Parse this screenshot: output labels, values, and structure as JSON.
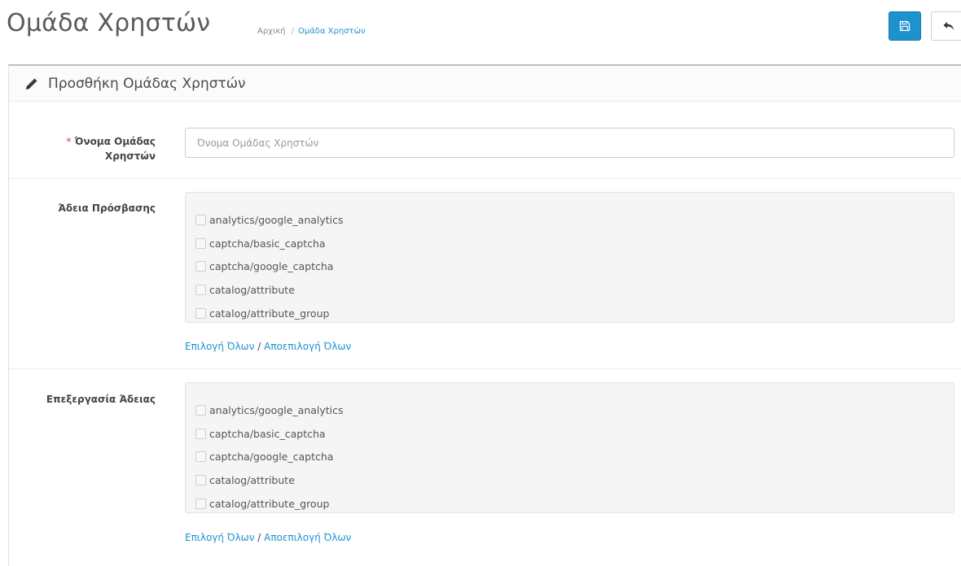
{
  "header": {
    "title": "Ομάδα Χρηστών",
    "breadcrumb": {
      "home": "Αρχική",
      "separator": "/",
      "current": "Ομάδα Χρηστών"
    },
    "buttons": {
      "save_icon": "save-icon",
      "back_icon": "reply-icon"
    }
  },
  "panel": {
    "icon": "pencil-icon",
    "title": "Προσθήκη Ομάδας Χρηστών"
  },
  "form": {
    "name_field": {
      "required_marker": "*",
      "label_line1": "Όνομα Ομάδας",
      "label_line2": "Χρηστών",
      "placeholder": "Όνομα Ομάδας Χρηστών",
      "value": ""
    },
    "access_permission": {
      "label": "Άδεια Πρόσβασης",
      "items": [
        {
          "label": "analytics/google_analytics",
          "checked": false
        },
        {
          "label": "captcha/basic_captcha",
          "checked": false
        },
        {
          "label": "captcha/google_captcha",
          "checked": false
        },
        {
          "label": "catalog/attribute",
          "checked": false
        },
        {
          "label": "catalog/attribute_group",
          "checked": false
        }
      ],
      "select_all": "Επιλογή Όλων",
      "separator": " / ",
      "deselect_all": "Αποεπιλογή Όλων"
    },
    "modify_permission": {
      "label": "Επεξεργασία Άδειας",
      "items": [
        {
          "label": "analytics/google_analytics",
          "checked": false
        },
        {
          "label": "captcha/basic_captcha",
          "checked": false
        },
        {
          "label": "captcha/google_captcha",
          "checked": false
        },
        {
          "label": "catalog/attribute",
          "checked": false
        },
        {
          "label": "catalog/attribute_group",
          "checked": false
        }
      ],
      "select_all": "Επιλογή Όλων",
      "separator": " / ",
      "deselect_all": "Αποεπιλογή Όλων"
    }
  },
  "colors": {
    "primary": "#1e91cf",
    "required": "#f56b6b",
    "well_bg": "#f5f5f5"
  }
}
